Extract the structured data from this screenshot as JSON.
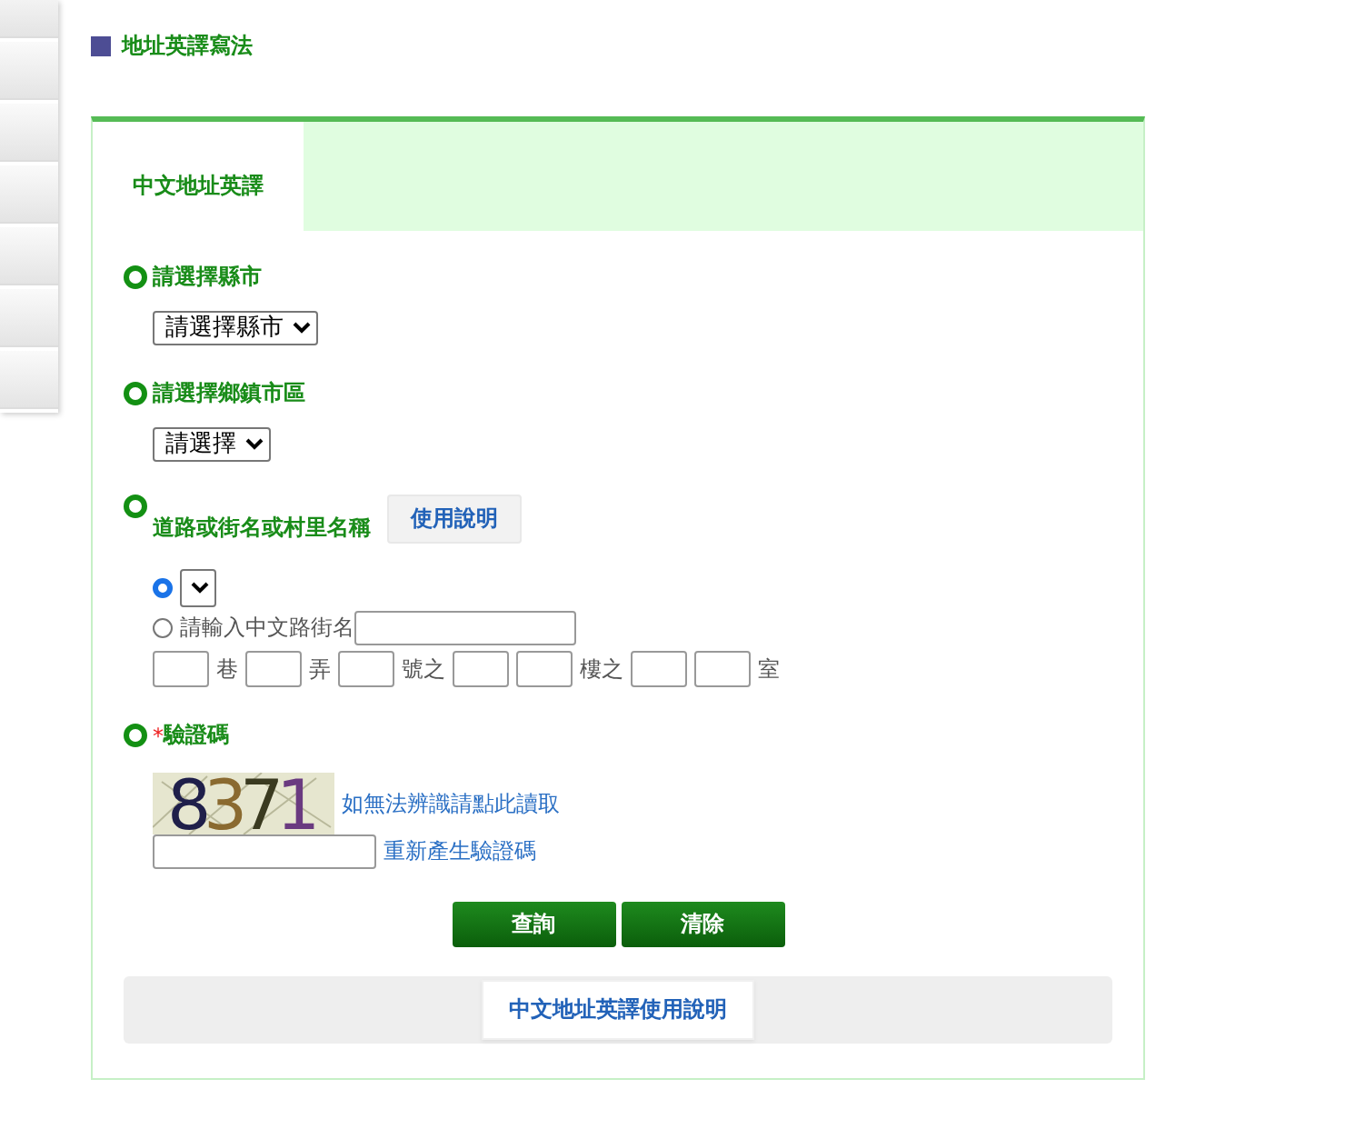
{
  "page_title": "地址英譯寫法",
  "tabs": [
    {
      "label": "中文地址英譯",
      "selected": true
    }
  ],
  "sections": [
    {
      "kind": "select",
      "label": "請選擇縣市",
      "value": "請選擇縣市"
    },
    {
      "kind": "select",
      "label": "請選擇鄉鎮市區",
      "value": "請選擇"
    },
    {
      "kind": "road",
      "label": "道路或街名或村里名稱",
      "help_button": "使用說明",
      "options": [
        {
          "kind": "select",
          "selected": true
        },
        {
          "kind": "text",
          "label": "請輸入中文路街名",
          "selected": false
        }
      ],
      "address_parts": [
        {
          "kind": "box",
          "suffix": "巷"
        },
        {
          "kind": "box",
          "suffix": "弄"
        },
        {
          "kind": "box",
          "suffix": "號之"
        },
        {
          "kind": "box"
        },
        {
          "kind": "box",
          "suffix": "樓之"
        },
        {
          "kind": "box"
        },
        {
          "kind": "box",
          "suffix": "室"
        }
      ]
    },
    {
      "kind": "captcha",
      "required_mark": "*",
      "label": "驗證碼",
      "code": "8371",
      "unreadable_link": "如無法辨識請點此讀取",
      "refresh_link": "重新產生驗證碼"
    }
  ],
  "buttons": [
    "查詢",
    "清除"
  ],
  "footer_button": "中文地址英譯使用說明"
}
